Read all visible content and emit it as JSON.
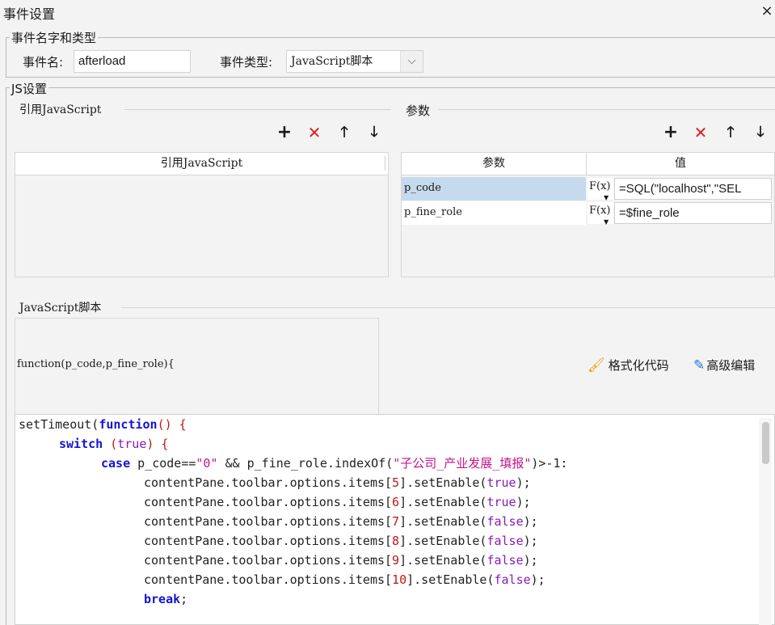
{
  "window": {
    "title": "事件设置",
    "close_icon": "×"
  },
  "event_section": {
    "legend": "事件名字和类型",
    "name_label": "事件名:",
    "name_value": "afterload",
    "type_label": "事件类型:",
    "type_value": "JavaScript脚本",
    "chevron": "⌵"
  },
  "js_section": {
    "legend": "JS设置",
    "ref_js": {
      "legend": "引用JavaScript",
      "column_header": "引用JavaScript",
      "toolbar": {
        "add": "+",
        "delete": "✕",
        "up": "🡑",
        "down": "🡓"
      }
    },
    "params": {
      "legend": "参数",
      "toolbar": {
        "add": "+",
        "delete": "✕",
        "up": "🡑",
        "down": "🡓"
      },
      "headers": {
        "param": "参数",
        "value": "值"
      },
      "rows": [
        {
          "name": "p_code",
          "fx": "F(x)",
          "value": "=SQL(\"localhost\",\"SEL"
        },
        {
          "name": "p_fine_role",
          "fx": "F(x)",
          "value": "=$fine_role"
        }
      ]
    },
    "script": {
      "legend": "JavaScript脚本",
      "signature": "function(p_code,p_fine_role){",
      "format_button": "格式化代码",
      "advanced_button": "高级编辑"
    }
  },
  "code": {
    "line1": {
      "a": "setTimeout(",
      "b": "function",
      "c": "() {"
    },
    "line2": {
      "a": "switch",
      "b": " (",
      "c": "true",
      "d": ") {"
    },
    "line3": {
      "a": "case",
      "b": " p_code==",
      "c": "\"0\"",
      "d": " && p_fine_role.indexOf(",
      "e": "\"子公司_产业发展_填报\"",
      "f": ")>-1:"
    },
    "items": [
      {
        "idx": "5",
        "val": "true"
      },
      {
        "idx": "6",
        "val": "true"
      },
      {
        "idx": "7",
        "val": "false"
      },
      {
        "idx": "8",
        "val": "false"
      },
      {
        "idx": "9",
        "val": "false"
      },
      {
        "idx": "10",
        "val": "false"
      }
    ],
    "prefix": "contentPane.toolbar.options.items[",
    "mid": "].setEnable(",
    "suffix": ");",
    "break_kw": "break",
    "break_suffix": ";"
  }
}
